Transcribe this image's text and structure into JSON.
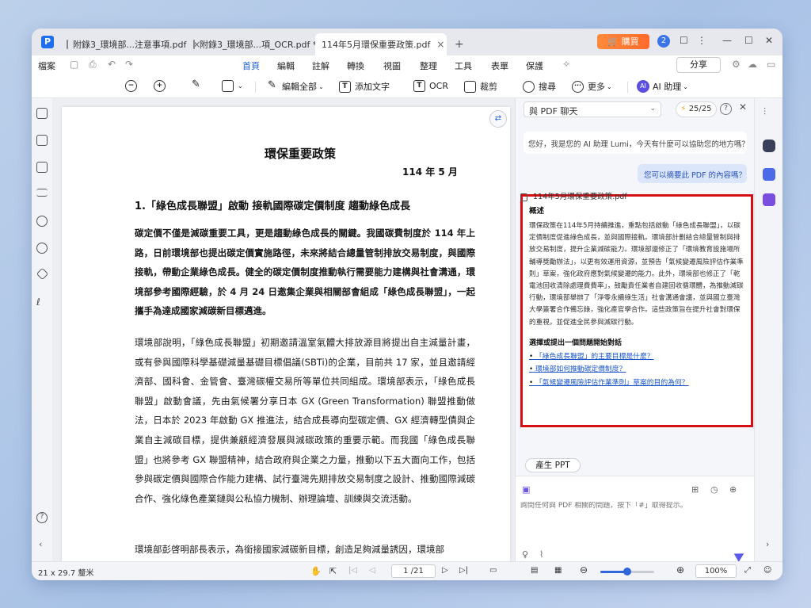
{
  "tabs": [
    {
      "label": "附錄3_環境部...注意事項.pdf"
    },
    {
      "label": "附錄3_環境部...項_OCR.pdf *"
    },
    {
      "label": "114年5月環保重要政策.pdf"
    }
  ],
  "tab_close": "×",
  "tab_add": "+",
  "buy_label": "🛒 購買",
  "avatar_initial": "2",
  "window_controls": {
    "min": "—",
    "max": "☐",
    "close": "✕"
  },
  "menu": {
    "file": "檔案",
    "items": [
      "首頁",
      "編輯",
      "註解",
      "轉換",
      "視圖",
      "整理",
      "工具",
      "表單",
      "保護"
    ],
    "active": "首頁",
    "share": "分享"
  },
  "toolbar": {
    "edit_all": "編輯全部",
    "add_text": "添加文字",
    "ocr": "OCR",
    "crop": "裁剪",
    "search": "搜尋",
    "more": "更多",
    "ai_assistant": "AI 助理",
    "ai_badge": "AI",
    "text_icon": "T"
  },
  "document": {
    "title": "環保重要政策",
    "date": "114 年 5 月",
    "heading": "1.「綠色成長聯盟」啟動 接軌國際碳定價制度 趨動綠色成長",
    "para1": "碳定價不僅是減碳重要工具，更是趨動綠色成長的關鍵。我國碳費制度於 114 年上路，日前環境部也提出碳定價實施路徑，未來將結合總量管制排放交易制度，與國際接軌，帶動企業綠色成長。健全的碳定價制度推動執行需要能力建構與社會溝通，環境部參考國際經驗，於 4 月 24 日邀集企業與相關部會組成「綠色成長聯盟」，一起攜手為達成國家減碳新目標邁進。",
    "para2": "環境部說明，「綠色成長聯盟」初期邀請溫室氣體大排放源目將提出自主減量計畫，或有參與國際科學基礎減量基礎目標倡議(SBTi)的企業，目前共 17 家，並且邀請經濟部、國科會、金管會、臺灣碳權交易所等單位共同組成。環境部表示，「綠色成長聯盟」啟動會議，先由氣候署分享日本 GX (Green Transformation) 聯盟推動做法，日本於 2023 年啟動 GX 推進法，結合成長導向型碳定價、GX 經濟轉型債與企業自主減碳目標，提供兼顧經濟發展與減碳政策的重要示範。而我國「綠色成長聯盟」也將參考 GX 聯盟精神，結合政府與企業之力量，推動以下五大面向工作，包括參與碳定價與國際合作能力建構、試行臺灣先期排放交易制度之設計、推動國際減碳合作、強化綠色產業鏈與公私協力機制、辦理論壇、訓練與交流活動。",
    "para3": "環境部彭啓明部長表示，為銜接國家減碳新目標，創造足夠減量誘因，環境部"
  },
  "chat": {
    "source_select": "與 PDF 聊天",
    "quota": "25/25",
    "greeting": "您好，我是您的 AI 助理 Lumi，今天有什麼可以協助您的地方嗎？",
    "user_message": "您可以摘要此 PDF 的內容嗎？",
    "answer_heading": "概述",
    "answer_text": "環保政策在114年5月持續推進，重點包括啟動「綠色成長聯盟」，以碳定價制度促進綠色成長，並與國際接軌。環境部計劃結合總量管制與排放交易制度，提升企業減碳能力。環境部還修正了「環境教育設施場所輔導獎勵辦法」，以更有效運用資源，並預告「氣候變遷風險評估作業準則」草案，強化政府應對氣候變遷的能力。此外，環境部也修正了「乾電池回收清除處理費費率」，鼓勵責任業者自建回收循環體，為推動減碳行動，環境部舉辦了「淨零永續綠生活」社會溝通會議，並與國立臺灣大學簽署合作備忘錄，強化產官學合作。這些政策旨在提升社會對環保的重視，並促進全民參與減碳行動。",
    "suggest_heading": "選擇或提出一個問題開始對話",
    "suggestions": [
      "「綠色成長聯盟」的主要目標是什麼？",
      "環境部如何推動碳定價制度？",
      "「氣候變遷風險評估作業準則」草案的目的為何？"
    ],
    "ppt_button": "產生 PPT",
    "input_placeholder": "詢問任何與 PDF 相關的問題，按下「#」取得提示。",
    "attached_file": "114年5月環保重要政策.pdf"
  },
  "status": {
    "page_size": "21 x 29.7 釐米",
    "page_indicator": "1 /21",
    "zoom": "100%",
    "zoom_fraction": 0.5
  },
  "colors": {
    "accent": "#1e5fd8",
    "highlight_border": "#d60f14",
    "buy": "#ff7a33"
  }
}
